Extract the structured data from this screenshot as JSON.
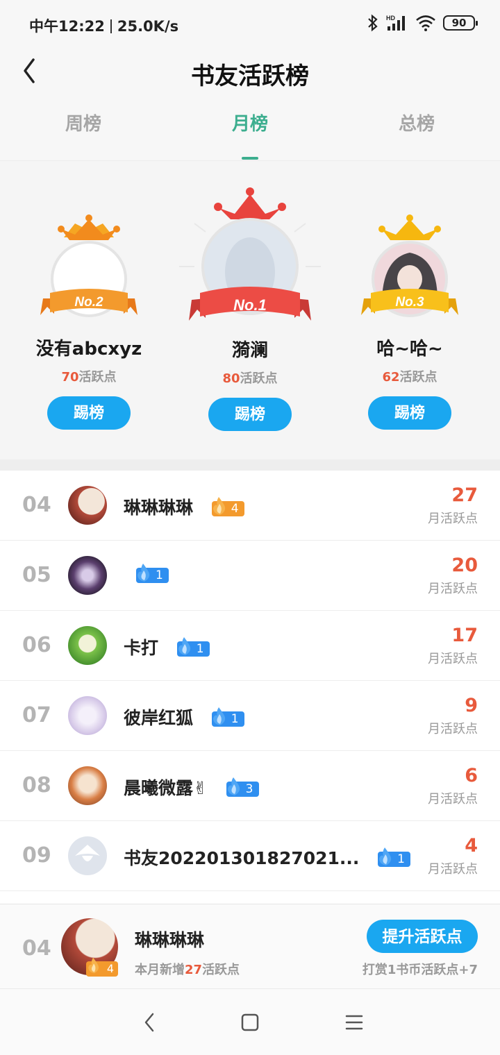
{
  "status": {
    "time": "中午12:22",
    "speed": "25.0K/s",
    "battery": "90",
    "network_label": "HD"
  },
  "header": {
    "title": "书友活跃榜"
  },
  "tabs": [
    {
      "label": "周榜"
    },
    {
      "label": "月榜"
    },
    {
      "label": "总榜"
    }
  ],
  "podium": {
    "first": {
      "badge": "No.1",
      "name": "漪澜",
      "points": "80",
      "points_unit": "活跃点",
      "button": "踢榜"
    },
    "second": {
      "badge": "No.2",
      "name": "没有abcxyz",
      "points": "70",
      "points_unit": "活跃点",
      "button": "踢榜"
    },
    "third": {
      "badge": "No.3",
      "name": "哈~哈~",
      "points": "62",
      "points_unit": "活跃点",
      "button": "踢榜"
    }
  },
  "list": [
    {
      "rank": "04",
      "name": "琳琳琳琳",
      "level": "4",
      "score": "27",
      "score_label": "月活跃点"
    },
    {
      "rank": "05",
      "name": "",
      "level": "1",
      "score": "20",
      "score_label": "月活跃点"
    },
    {
      "rank": "06",
      "name": "卡打",
      "level": "1",
      "score": "17",
      "score_label": "月活跃点"
    },
    {
      "rank": "07",
      "name": "彼岸红狐",
      "level": "1",
      "score": "9",
      "score_label": "月活跃点"
    },
    {
      "rank": "08",
      "name": "晨曦微露✌",
      "level": "3",
      "score": "6",
      "score_label": "月活跃点"
    },
    {
      "rank": "09",
      "name": "书友20220130182702​1...",
      "level": "1",
      "score": "4",
      "score_label": "月活跃点"
    }
  ],
  "me": {
    "rank": "04",
    "level": "4",
    "name": "琳琳琳琳",
    "sub_prefix": "本月新增",
    "sub_value": "27",
    "sub_suffix": "活跃点",
    "button": "提升活跃点",
    "hint": "打赏1书币活跃点+7"
  },
  "colors": {
    "accent_green": "#3dae8f",
    "button_blue": "#1aa7f0",
    "score_red": "#e85a3c"
  }
}
